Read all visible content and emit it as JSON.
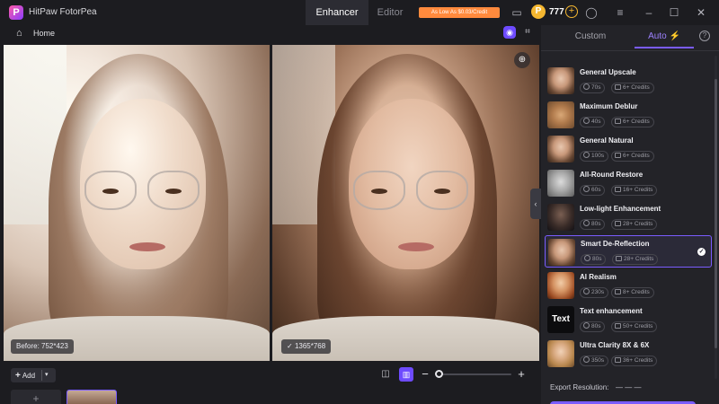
{
  "app": {
    "title": "HitPaw FotorPea",
    "logo_letter": "P",
    "tabs": [
      {
        "label": "Enhancer",
        "active": true
      },
      {
        "label": "Editor",
        "active": false
      }
    ],
    "promo": "As Low As $0.03/Credit",
    "credits": "777"
  },
  "toolbar": {
    "home_label": "Home"
  },
  "preview": {
    "before_label": "Before: 752*423",
    "after_label": "1365*768"
  },
  "bottom": {
    "add_label": "Add",
    "add_plus": "+"
  },
  "panel": {
    "tabs": [
      {
        "label": "Custom",
        "active": false
      },
      {
        "label": "Auto",
        "active": true
      }
    ],
    "models": [
      {
        "name": "General Upscale",
        "time": "70s",
        "credits": "6+ Credits",
        "thumb": "face",
        "selected": false
      },
      {
        "name": "Maximum Deblur",
        "time": "40s",
        "credits": "6+ Credits",
        "thumb": "cat",
        "selected": false
      },
      {
        "name": "General Natural",
        "time": "100s",
        "credits": "6+ Credits",
        "thumb": "face",
        "selected": false
      },
      {
        "name": "All-Round Restore",
        "time": "60s",
        "credits": "16+ Credits",
        "thumb": "old",
        "selected": false
      },
      {
        "name": "Low-light Enhancement",
        "time": "80s",
        "credits": "28+ Credits",
        "thumb": "dark",
        "selected": false
      },
      {
        "name": "Smart De-Reflection",
        "time": "80s",
        "credits": "28+ Credits",
        "thumb": "face",
        "selected": true
      },
      {
        "name": "AI Realism",
        "time": "230s",
        "credits": "8+ Credits",
        "thumb": "red",
        "selected": false
      },
      {
        "name": "Text enhancement",
        "time": "80s",
        "credits": "50+ Credits",
        "thumb": "text",
        "thumb_text": "Text",
        "selected": false
      },
      {
        "name": "Ultra Clarity 8X & 6X",
        "time": "350s",
        "credits": "36+ Credits",
        "thumb": "blond",
        "selected": false
      }
    ],
    "export_label": "Export Resolution:",
    "export_value": "— — —"
  },
  "colors": {
    "accent": "#7a5cff",
    "background": "#1c1c20",
    "panel": "#232328",
    "coin": "#f5b731",
    "promo": "#ff8a3d"
  }
}
